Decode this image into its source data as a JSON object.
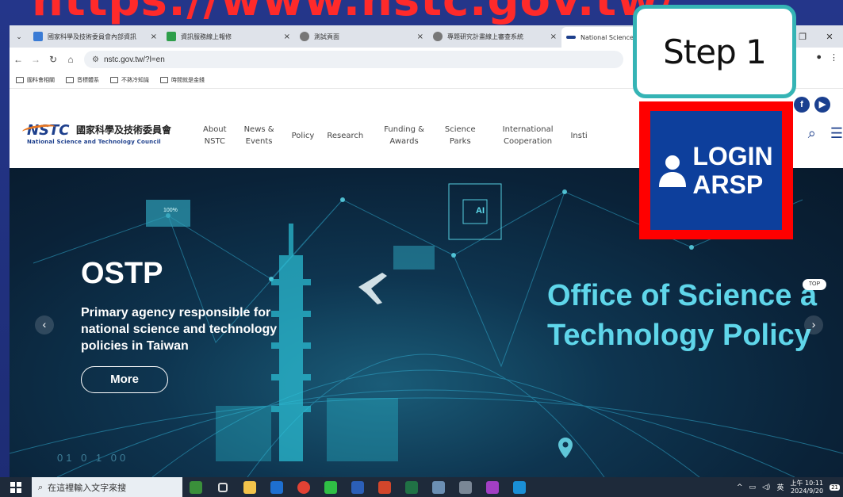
{
  "slide": {
    "url_title": "https://www.nstc.gov.tw/",
    "step_label": "Step 1"
  },
  "browser": {
    "tabs": [
      {
        "title": "國家科學及技術委員會內部資訊",
        "active": false,
        "icon": "nstc-favicon",
        "icon_color": "#3a7bd5"
      },
      {
        "title": "資訊服務線上報修",
        "active": false,
        "icon": "h-favicon",
        "icon_color": "#2e9e4a"
      },
      {
        "title": "測試頁面",
        "active": false,
        "icon": "globe-icon",
        "icon_color": "#666666"
      },
      {
        "title": "專題研究計畫線上審查系統",
        "active": false,
        "icon": "globe-icon",
        "icon_color": "#666666"
      },
      {
        "title": "National Science and",
        "active": true,
        "icon": "nstc-favicon",
        "icon_color": "#1d3f8c"
      }
    ],
    "address": "nstc.gov.tw/?l=en",
    "bookmarks": [
      "國科會相關",
      "音標體系",
      "不熟冷知識",
      "時間就是金錢"
    ]
  },
  "site": {
    "logo_mark": "NSTC",
    "logo_zh": "國家科學及技術委員會",
    "logo_en": "National Science and Technology Council",
    "nav": [
      "About\nNSTC",
      "News &\nEvents",
      "Policy",
      "Research",
      "Funding &\nAwards",
      "Science\nParks",
      "International\nCooperation",
      "Insti"
    ],
    "social": [
      "f",
      "▶"
    ],
    "login": {
      "line1": "LOGIN",
      "line2": "ARSP"
    }
  },
  "hero": {
    "title": "OSTP",
    "description": "Primary agency responsible for national science and technology policies in Taiwan",
    "more_label": "More",
    "big_line1": "Office of Science a",
    "big_line2": "Technology Policy",
    "top_badge": "TOP",
    "ai_chip": "AI",
    "percent": "100%",
    "binary": "01 0 1 00"
  },
  "taskbar": {
    "search_placeholder": "在這裡輸入文字來搜",
    "ime": "英",
    "time": "上午 10:11",
    "date": "2024/9/20",
    "notif_count": "21"
  },
  "colors": {
    "callout_red": "#ff0000",
    "callout_teal": "#35b4b5",
    "login_blue": "#0d3f9c",
    "url_red": "#ff2a2a",
    "hero_cyan": "#5fd6ea"
  }
}
